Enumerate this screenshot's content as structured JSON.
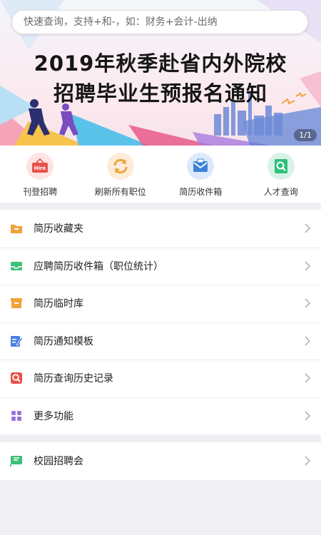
{
  "search": {
    "placeholder": "快速查询，支持+和-，如：财务+会计-出纳"
  },
  "banner": {
    "title_line1": "2019年秋季赴省内外院校",
    "title_line2": "招聘毕业生预报名通知",
    "pager": "1/1"
  },
  "quick_actions": [
    {
      "label": "刊登招聘",
      "icon": "hire-icon",
      "color": "#e8524a"
    },
    {
      "label": "刷新所有职位",
      "icon": "refresh-icon",
      "color": "#f3a23b"
    },
    {
      "label": "简历收件箱",
      "icon": "mail-icon",
      "color": "#3b82d6"
    },
    {
      "label": "人才查询",
      "icon": "search-icon",
      "color": "#2fbf7a"
    }
  ],
  "menu": [
    {
      "label": "简历收藏夹",
      "icon": "folder-icon",
      "color": "#f0a33a"
    },
    {
      "label": "应聘简历收件箱（职位统计）",
      "icon": "inbox-icon",
      "color": "#3cc07a"
    },
    {
      "label": "简历临时库",
      "icon": "box-icon",
      "color": "#f0a33a"
    },
    {
      "label": "简历通知模板",
      "icon": "edit-icon",
      "color": "#4a7fe0"
    },
    {
      "label": "简历查询历史记录",
      "icon": "history-search-icon",
      "color": "#e8524a"
    },
    {
      "label": "更多功能",
      "icon": "grid-icon",
      "color": "#9b72e0"
    }
  ],
  "menu2": [
    {
      "label": "校园招聘会",
      "icon": "flag-icon",
      "color": "#3cc07a"
    }
  ]
}
